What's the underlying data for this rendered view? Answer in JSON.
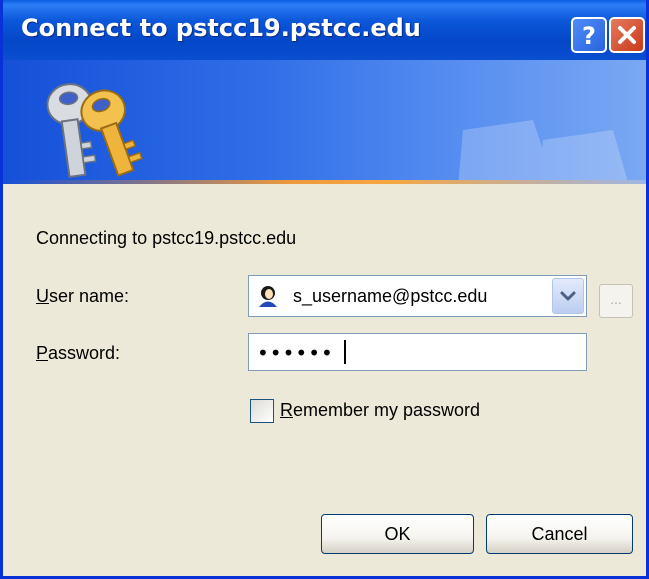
{
  "window": {
    "title": "Connect to pstcc19.pstcc.edu"
  },
  "titlebar_buttons": {
    "help": "?",
    "close": "X"
  },
  "dialog": {
    "connecting_text": "Connecting to pstcc19.pstcc.edu",
    "username_label": "User name:",
    "username_value": "s_username@pstcc.edu",
    "password_label": "Password:",
    "password_value": "••••••",
    "remember_label": "Remember my password",
    "remember_checked": false,
    "browse_button": "...",
    "ok_label": "OK",
    "cancel_label": "Cancel"
  },
  "colors": {
    "title_blue": "#0447c8",
    "window_face": "#ece9d8",
    "close_red": "#c9391a"
  }
}
